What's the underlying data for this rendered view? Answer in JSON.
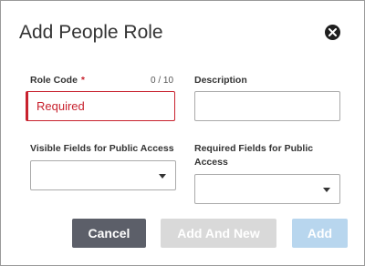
{
  "dialog": {
    "title": "Add People Role",
    "close_icon": "close-circle-icon"
  },
  "form": {
    "role_code": {
      "label": "Role Code",
      "required_marker": "*",
      "counter": "0 / 10",
      "value": "",
      "placeholder": "Required"
    },
    "description": {
      "label": "Description",
      "value": "",
      "placeholder": ""
    },
    "visible_fields": {
      "label": "Visible Fields for Public Access",
      "selected": "",
      "icon": "chevron-down-icon"
    },
    "required_fields": {
      "label_line1": "Required Fields for Public",
      "label_line2": "Access",
      "selected": "",
      "icon": "chevron-down-icon"
    }
  },
  "buttons": {
    "cancel": "Cancel",
    "add_and_new": "Add And New",
    "add": "Add"
  },
  "colors": {
    "error": "#c8222e",
    "cancel_bg": "#5c5f69",
    "disabled_bg": "#d9d9d9",
    "add_disabled_bg": "#b8d6ee"
  }
}
